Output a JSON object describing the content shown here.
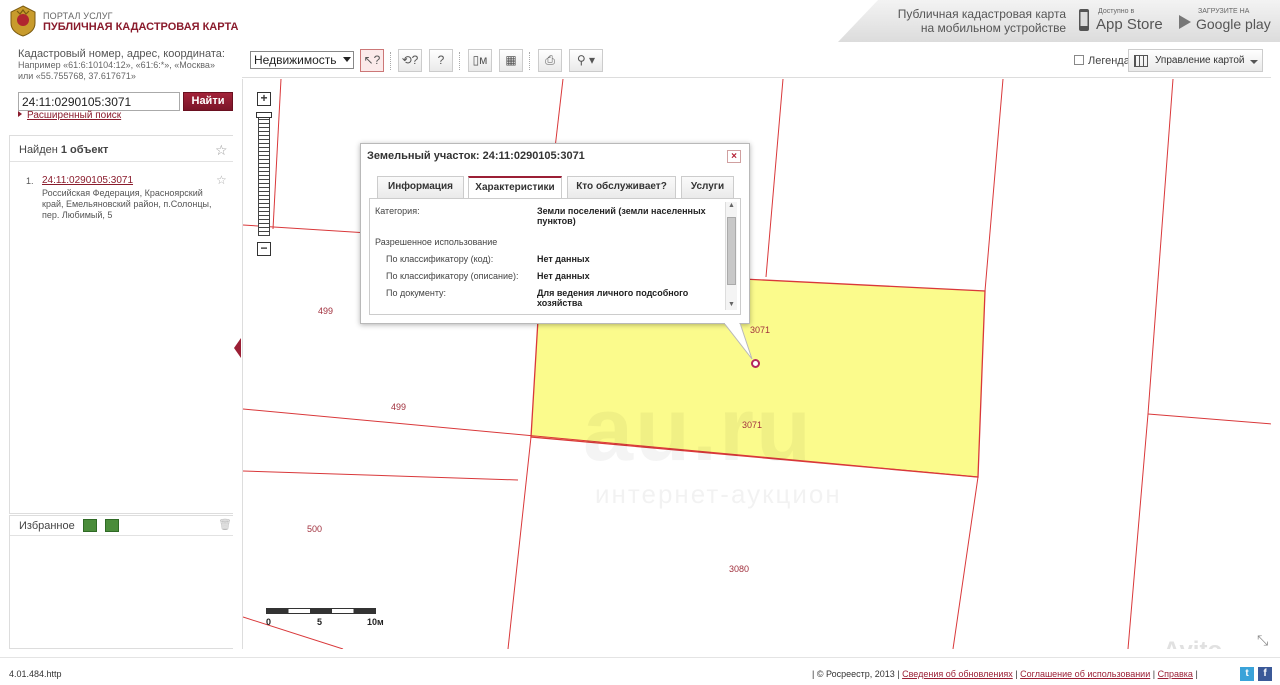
{
  "header": {
    "portal_label": "ПОРТАЛ УСЛУГ",
    "title": "ПУБЛИЧНАЯ КАДАСТРОВАЯ КАРТА",
    "mobile_text_line1": "Публичная кадастровая карта",
    "mobile_text_line2": "на мобильном устройстве",
    "appstore_small": "Доступно в",
    "appstore_big": "App Store",
    "gplay_small": "ЗАГРУЗИТЕ НА",
    "gplay_big": "Google play"
  },
  "search": {
    "hint": "Кадастровый номер, адрес, координата:",
    "example": "Например «61:6:10104:12», «61:6:*», «Москва» или «55.755768, 37.617671»",
    "value": "24:11:0290105:3071",
    "button": "Найти",
    "advanced_link": "Расширенный поиск"
  },
  "results": {
    "found_prefix": "Найден ",
    "found_count": "1 объект",
    "items": [
      {
        "num": "1.",
        "cad_number": "24:11:0290105:3071",
        "address": "Российская Федерация, Красноярский край, Емельяновский район, п.Солонцы, пер. Любимый, 5"
      }
    ]
  },
  "favorites": {
    "title": "Избранное"
  },
  "toolbar": {
    "layer_select": "Недвижимость",
    "legend": "Легенда",
    "map_control": "Управление картой"
  },
  "map": {
    "labels": [
      "499",
      "499",
      "500",
      "3071",
      "3071",
      "3080"
    ],
    "scale_labels": [
      "0",
      "5",
      "10м"
    ],
    "watermark": "au.ru",
    "watermark_sub": "интернет-аукцион",
    "avito_watermark": "Avito"
  },
  "popup": {
    "title": "Земельный участок: 24:11:0290105:3071",
    "close": "×",
    "tabs": [
      "Информация",
      "Характеристики",
      "Кто обслуживает?",
      "Услуги"
    ],
    "active_tab": 1,
    "props": [
      {
        "label": "Категория:",
        "value": "Земли поселений (земли населенных пунктов)"
      },
      {
        "label": "Разрешенное использование",
        "value": ""
      },
      {
        "label": "По классификатору (код):",
        "value": "Нет данных"
      },
      {
        "label": "По классификатору (описание):",
        "value": "Нет данных"
      },
      {
        "label": "По документу:",
        "value": "Для ведения личного подсобного хозяйства"
      }
    ]
  },
  "footer": {
    "version": "4.01.484.http",
    "copyright": "| © Росреестр, 2013 |",
    "link_updates": "Сведения об обновлениях",
    "link_terms": "Соглашение об использовании",
    "link_help": "Справка",
    "sep": "|"
  },
  "colors": {
    "brand": "#8a1b2c",
    "parcel_fill": "#fbfb8c",
    "parcel_line": "#d9383a"
  }
}
